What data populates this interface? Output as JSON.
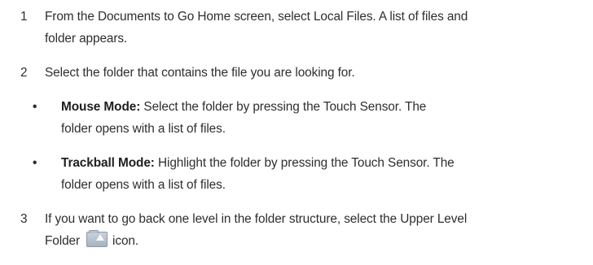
{
  "steps": [
    {
      "number": "1",
      "line1": "From the Documents to Go Home screen, select Local Files. A list of files and",
      "line2": "folder appears."
    },
    {
      "number": "2",
      "line1": "Select the folder that contains the file you are looking for.",
      "bullets": [
        {
          "symbol": "•",
          "term": "Mouse Mode:",
          "line1_rest": " Select the folder by pressing the Touch Sensor. The",
          "line2": "folder opens with a list of files."
        },
        {
          "symbol": "•",
          "term": "Trackball Mode:",
          "line1_rest": " Highlight the folder by pressing the Touch Sensor. The",
          "line2": "folder opens with a list of files."
        }
      ]
    },
    {
      "number": "3",
      "line1": "If you want to go back one level in the folder structure, select the Upper Level",
      "line2_before": "Folder",
      "line2_after": "icon.",
      "icon": "upper-level-folder-icon"
    }
  ]
}
